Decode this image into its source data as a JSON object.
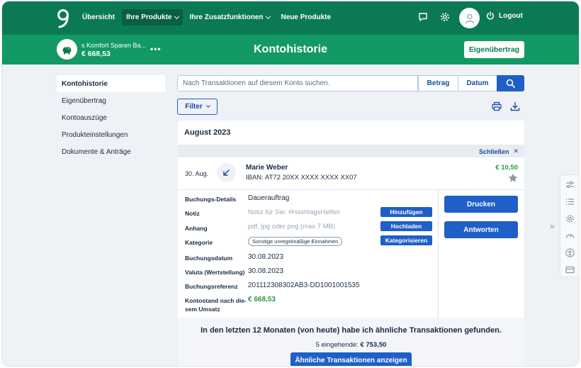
{
  "topbar": {
    "nav": [
      {
        "label": "Übersicht",
        "active": false,
        "dropdown": false
      },
      {
        "label": "Ihre Produkte",
        "active": true,
        "dropdown": true
      },
      {
        "label": "Ihre Zusatzfunktionen",
        "active": false,
        "dropdown": true
      },
      {
        "label": "Neue Produkte",
        "active": false,
        "dropdown": false
      }
    ],
    "icons": [
      "chat-icon",
      "gear-icon",
      "avatar-icon"
    ],
    "logout_label": "Logout"
  },
  "account": {
    "name": "s Komfort Sparen Ba...",
    "balance": "€ 668,53",
    "more": "•••"
  },
  "header": {
    "title": "Kontohistorie",
    "transfer_button": "Eigenübertrag"
  },
  "sidebar": {
    "items": [
      {
        "label": "Kontohistorie",
        "active": true
      },
      {
        "label": "Eigenübertrag",
        "active": false
      },
      {
        "label": "Kontoauszüge",
        "active": false
      },
      {
        "label": "Produkteinstellungen",
        "active": false
      },
      {
        "label": "Dokumente & Anträge",
        "active": false
      }
    ]
  },
  "search": {
    "placeholder": "Nach Transaktionen auf diesem Konto suchen.",
    "amount_button": "Betrag",
    "date_button": "Datum"
  },
  "filter": {
    "label": "Filter"
  },
  "history": {
    "month": "August 2023",
    "close_label": "Schließen",
    "transaction": {
      "date": "30. Aug.",
      "name": "Marie Weber",
      "iban": "IBAN: AT72 20XX XXXX XXXX XX07",
      "amount": "€ 10,50"
    },
    "details": {
      "booking_details_label": "Buchungs-Details",
      "booking_details_value": "Dauerauftrag",
      "note_label": "Notiz",
      "note_placeholder": "Notiz für Sie: #HashtagsHelfen",
      "note_button": "Hinzufügen",
      "attachment_label": "Anhang",
      "attachment_placeholder": "pdf, jpg oder png (max 7 MB)",
      "attachment_button": "Hochladen",
      "category_label": "Kategorie",
      "category_value": "Sonstige unregelmäßige Einnahmen",
      "category_button": "Kategorisieren",
      "booking_date_label": "Buchungsdatum",
      "booking_date_value": "30.08.2023",
      "value_date_label": "Valuta (Wertstellung)",
      "value_date_value": "30.08.2023",
      "reference_label": "Buchungsreferenz",
      "reference_value": "201112308302AB3-DD1001001535",
      "balance_label_1": "Kontostand nach die-",
      "balance_label_2": "sem Umsatz",
      "balance_value": "€ 668,53"
    },
    "actions": {
      "print": "Drucken",
      "reply": "Antworten"
    },
    "similar": {
      "title": "In den letzten 12 Monaten (von heute) habe ich ähnliche Transaktionen gefunden.",
      "summary_prefix": "5 eingehende:",
      "summary_amount": "€ 753,50",
      "button": "Ähnliche Transaktionen anzeigen"
    }
  },
  "colors": {
    "topbar": "#0b7a52",
    "subbar": "#129964",
    "primary": "#1f5fc7",
    "positive": "#2b9a45"
  }
}
